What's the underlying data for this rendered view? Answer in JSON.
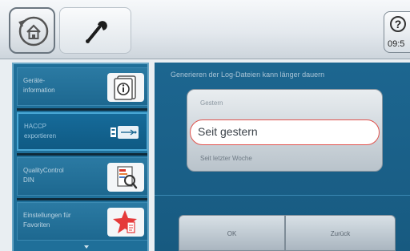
{
  "header": {
    "home_icon": "home-back-icon",
    "tools_icon": "wrench-icon",
    "help_icon": "help-question-icon",
    "help_symbol": "?",
    "time": "09:5"
  },
  "sidebar": {
    "items": [
      {
        "label": "Geräte-\ninformation",
        "icon": "device-info-icon",
        "selected": false
      },
      {
        "label": "HACCP\nexportieren",
        "icon": "usb-export-icon",
        "selected": true
      },
      {
        "label": "QualityControl\nDIN",
        "icon": "quality-control-icon",
        "selected": false
      },
      {
        "label": "Einstellungen für\nFavoriten",
        "icon": "favorites-star-icon",
        "selected": false
      }
    ],
    "scroll_indicator": "chevron-down-icon"
  },
  "main": {
    "hint": "Generieren der Log-Dateien kann länger dauern",
    "options": [
      {
        "label": "Gestern",
        "selected": false
      },
      {
        "label": "Seit gestern",
        "selected": true
      },
      {
        "label": "Seit letzter Woche",
        "selected": false
      }
    ],
    "ok_label": "OK",
    "back_label": "Zurück"
  },
  "colors": {
    "accent": "#1f6f99",
    "selected_outline": "#e0524d",
    "favorite_star": "#e53a3a"
  }
}
